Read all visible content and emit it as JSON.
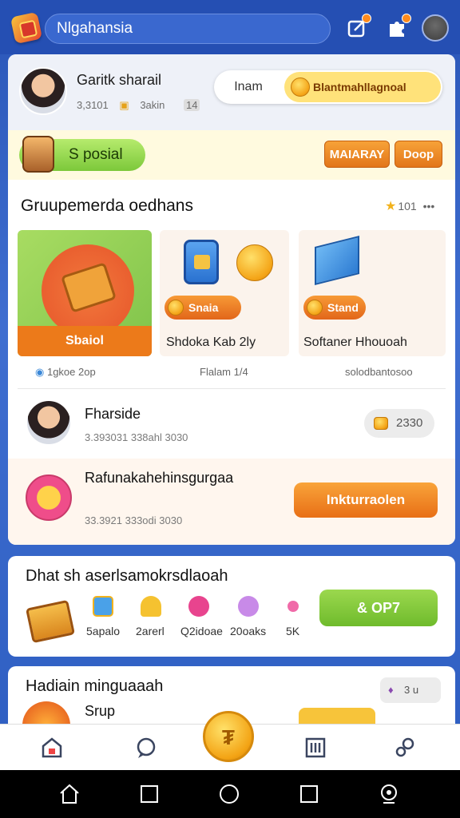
{
  "topbar": {
    "search_text": "Nlgahansia",
    "icons": [
      "app-logo",
      "edit-notification-icon",
      "puzzle-notification-icon",
      "profile-avatar"
    ]
  },
  "profile": {
    "name": "Garitk sharail",
    "meta": [
      "3,3101",
      "3akin",
      "14"
    ],
    "pill_left": "Inam",
    "pill_right": "Blantmahllagnoal"
  },
  "special": {
    "button_label": "S posial",
    "btn_majaray": "MAIARAY",
    "btn_doop": "Doop"
  },
  "section": {
    "title": "Gruupemerda oedhans",
    "meta": "101",
    "more": "•••"
  },
  "tiles": [
    {
      "label": "Sbaiol",
      "caption": "",
      "sub": "1gkoe 2op"
    },
    {
      "badge": "Snaia",
      "caption": "Shdoka  Kab 2ly",
      "sub": "Flalam 1/4"
    },
    {
      "badge": "Stand",
      "caption": "Softaner  Hhouoah",
      "sub": "solodbantosoo"
    }
  ],
  "rows": [
    {
      "title": "Fharside",
      "meta": "3.393031 338ahl  3030",
      "pill": "2330"
    },
    {
      "title": "Rafunakahehinsgurgaa",
      "meta": "33.3921 333odi  3030",
      "button": "Inkturraolen"
    }
  ],
  "card2": {
    "title": "Dhat sh aserlsamokrsdlaoah",
    "items": [
      "5apalo",
      "2arerl",
      "Q2idoae",
      "20oaks",
      "5K"
    ],
    "button": "& OP7"
  },
  "card3": {
    "title": "Hadiain minguaaah",
    "sub": "Srup",
    "pill": "3 u"
  },
  "colors": {
    "accent_blue": "#2a56b8",
    "orange": "#ec7a1a",
    "green": "#7cc83a",
    "gold": "#f3a314"
  }
}
